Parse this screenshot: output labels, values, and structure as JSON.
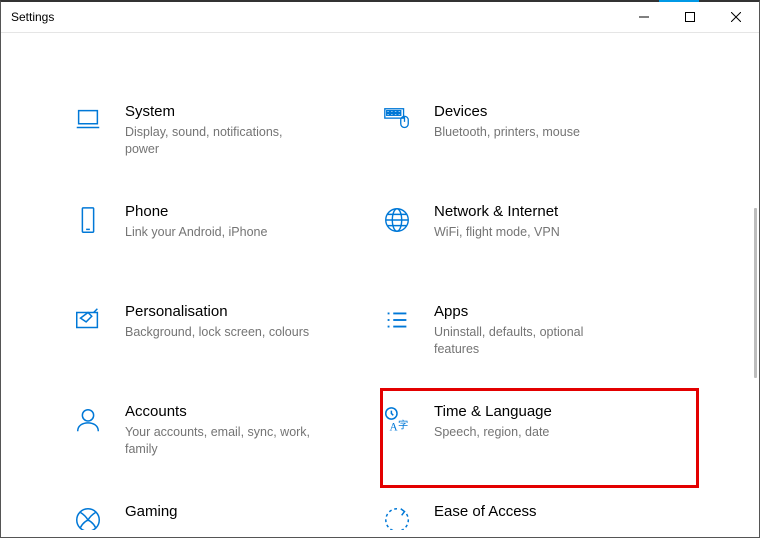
{
  "window": {
    "title": "Settings"
  },
  "categories": [
    {
      "title": "System",
      "sub": "Display, sound, notifications, power"
    },
    {
      "title": "Devices",
      "sub": "Bluetooth, printers, mouse"
    },
    {
      "title": "Phone",
      "sub": "Link your Android, iPhone"
    },
    {
      "title": "Network & Internet",
      "sub": "WiFi, flight mode, VPN"
    },
    {
      "title": "Personalisation",
      "sub": "Background, lock screen, colours"
    },
    {
      "title": "Apps",
      "sub": "Uninstall, defaults, optional features"
    },
    {
      "title": "Accounts",
      "sub": "Your accounts, email, sync, work, family"
    },
    {
      "title": "Time & Language",
      "sub": "Speech, region, date"
    },
    {
      "title": "Gaming",
      "sub": ""
    },
    {
      "title": "Ease of Access",
      "sub": ""
    }
  ]
}
